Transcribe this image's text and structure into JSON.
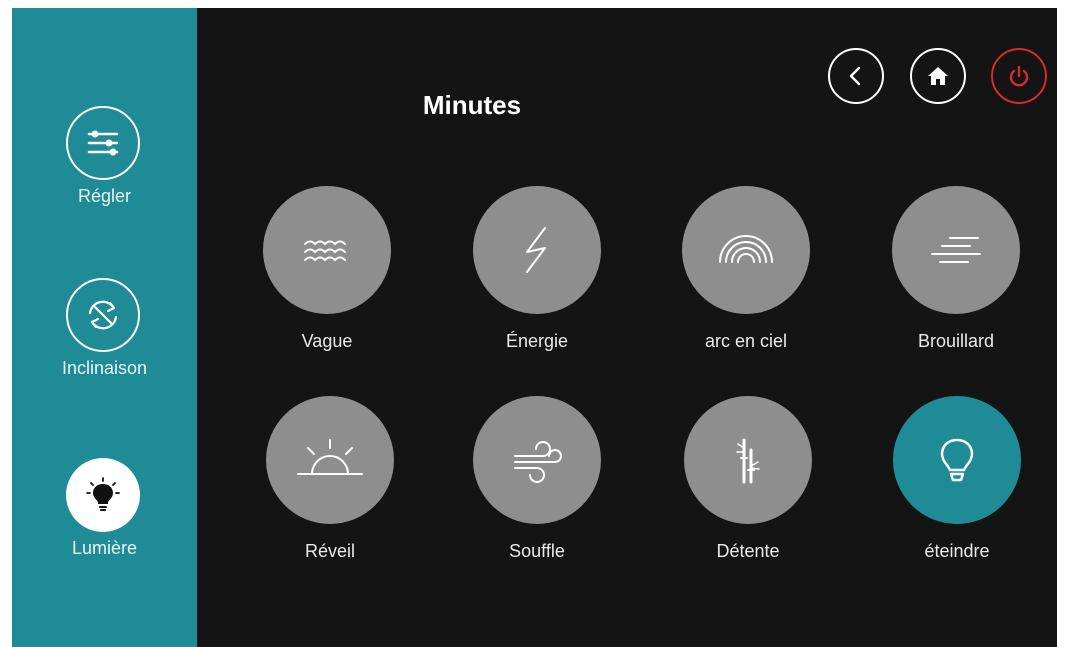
{
  "colors": {
    "accent": "#1f8b97",
    "tile": "#8e8e8e",
    "power": "#d62c2c",
    "background": "#141414"
  },
  "sidebar": {
    "items": [
      {
        "label": "Régler",
        "icon": "sliders-icon",
        "active": false
      },
      {
        "label": "Inclinaison",
        "icon": "rotate-arrows-icon",
        "active": false
      },
      {
        "label": "Lumière",
        "icon": "lightbulb-icon",
        "active": true
      }
    ]
  },
  "header": {
    "title": "Minutes",
    "buttons": [
      {
        "icon": "chevron-left-icon",
        "name": "back"
      },
      {
        "icon": "home-icon",
        "name": "home"
      },
      {
        "icon": "power-icon",
        "name": "power"
      }
    ]
  },
  "modes": [
    {
      "label": "Vague",
      "icon": "waves-icon"
    },
    {
      "label": "Énergie",
      "icon": "lightning-icon"
    },
    {
      "label": "arc en ciel",
      "icon": "rainbow-icon"
    },
    {
      "label": "Brouillard",
      "icon": "fog-icon"
    },
    {
      "label": "Réveil",
      "icon": "sunrise-icon"
    },
    {
      "label": "Souffle",
      "icon": "wind-icon"
    },
    {
      "label": "Détente",
      "icon": "bamboo-icon"
    },
    {
      "label": "éteindre",
      "icon": "lightbulb-outline-icon",
      "active": true
    }
  ]
}
